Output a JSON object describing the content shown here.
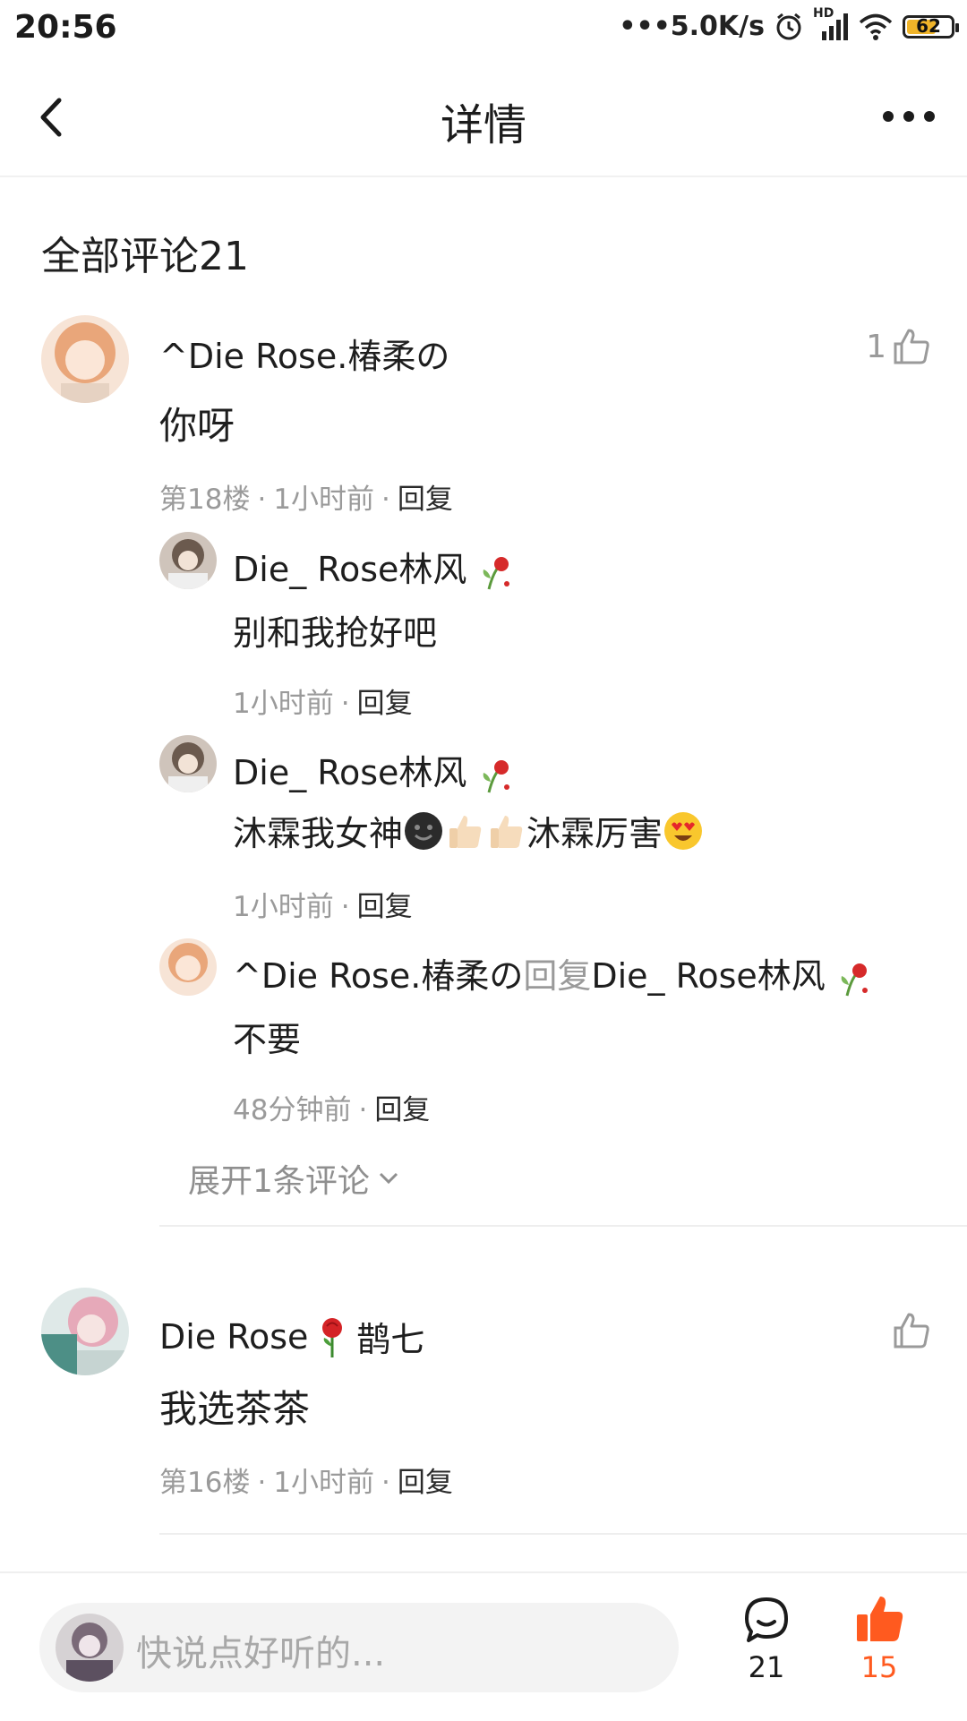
{
  "status_bar": {
    "time": "20:56",
    "network_speed": "•••5.0K/s",
    "signal_label": "HD",
    "battery": "62"
  },
  "header": {
    "title": "详情"
  },
  "comments_title": "全部评论21",
  "comments": [
    {
      "username": "^Die Rose.椿柔の",
      "text": "你呀",
      "floor": "第18楼",
      "time": "1小时前",
      "reply_label": "回复",
      "likes": "1",
      "replies": [
        {
          "username": "Die_ Rose林风",
          "text": "别和我抢好吧",
          "time": "1小时前",
          "reply_label": "回复"
        },
        {
          "username": "Die_ Rose林风",
          "text": "沐霖我女神",
          "text_mid": "沐霖厉害",
          "time": "1小时前",
          "reply_label": "回复"
        },
        {
          "username": "^Die Rose.椿柔の",
          "reply_word": "回复",
          "reply_to": "Die_ Rose林风",
          "text": "不要",
          "time": "48分钟前",
          "reply_label": "回复"
        }
      ],
      "expand": "展开1条评论"
    },
    {
      "username_a": "Die Rose",
      "username_b": "鹊七",
      "text": "我选茶茶",
      "floor": "第16楼",
      "time": "1小时前",
      "reply_label": "回复",
      "likes": ""
    }
  ],
  "bottom_bar": {
    "placeholder": "快说点好听的...",
    "comment_count": "21",
    "like_count": "15"
  },
  "colors": {
    "accent": "#ff5a1f",
    "muted": "#9a9a9a"
  }
}
